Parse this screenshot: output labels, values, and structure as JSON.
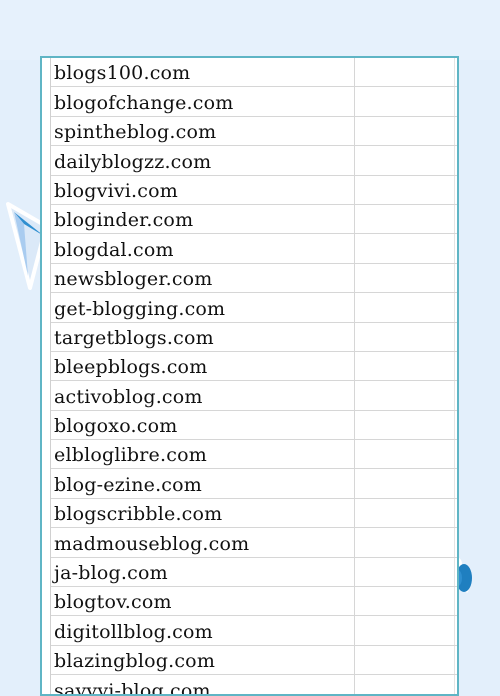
{
  "spreadsheet": {
    "rows": [
      "blogs100.com",
      "blogofchange.com",
      "spintheblog.com",
      "dailyblogzz.com",
      "blogvivi.com",
      "bloginder.com",
      "blogdal.com",
      "newsbloger.com",
      "get-blogging.com",
      "targetblogs.com",
      "bleepblogs.com",
      "activoblog.com",
      "blogoxo.com",
      "elbloglibre.com",
      "blog-ezine.com",
      "blogscribble.com",
      "madmouseblog.com",
      "ja-blog.com",
      "blogtov.com",
      "digitollblog.com",
      "blazingblog.com",
      "savvyi-blog.com"
    ]
  },
  "colors": {
    "background": "#e3effb",
    "sheet_border": "#5fb5c5",
    "grid_line": "#d6d6d6",
    "accent_blue": "#2f8fd0"
  },
  "icons": {
    "left_decoration": "paper-plane-icon",
    "right_decoration": "cloud-icon"
  }
}
